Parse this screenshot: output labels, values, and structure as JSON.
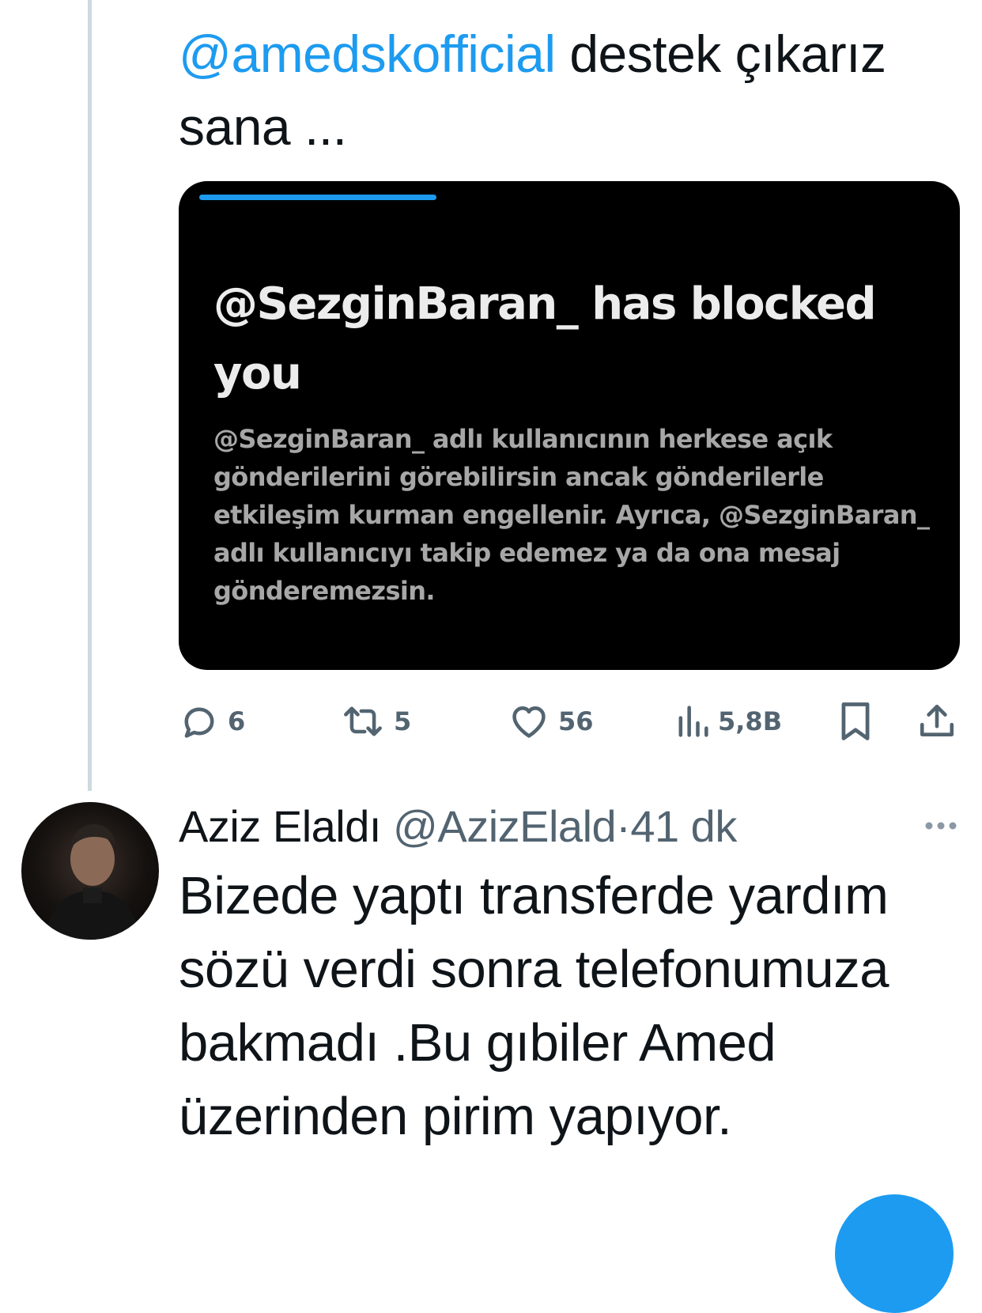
{
  "tweet1": {
    "mention": "@amedskofficial",
    "text_rest": " destek çıkarız sana ...",
    "media": {
      "title": "@SezginBaran_ has blocked you",
      "body": "@SezginBaran_ adlı kullanıcının herkese açık gönderilerini görebilirsin ancak gönderilerle etkileşim kurman engellenir. Ayrıca, @SezginBaran_ adlı kullanıcıyı takip edemez ya da ona mesaj gönderemezsin."
    },
    "actions": {
      "replies": "6",
      "retweets": "5",
      "likes": "56",
      "views": "5,8B"
    }
  },
  "tweet2": {
    "name": "Aziz Elaldı",
    "handle": "@AzizElald",
    "separator": "·",
    "time": "41 dk",
    "text": "Bizede yaptı transferde yardım sözü verdi sonra telefonumuza bakmadı .Bu gıbiler Amed üzerinden pirim yapıyor."
  },
  "colors": {
    "accent": "#1d9bf0",
    "text": "#0f1419",
    "secondary": "#536471",
    "media_background": "#000000"
  },
  "icons": [
    "reply-icon",
    "retweet-icon",
    "like-icon",
    "views-icon",
    "bookmark-icon",
    "share-icon",
    "more-icon"
  ]
}
